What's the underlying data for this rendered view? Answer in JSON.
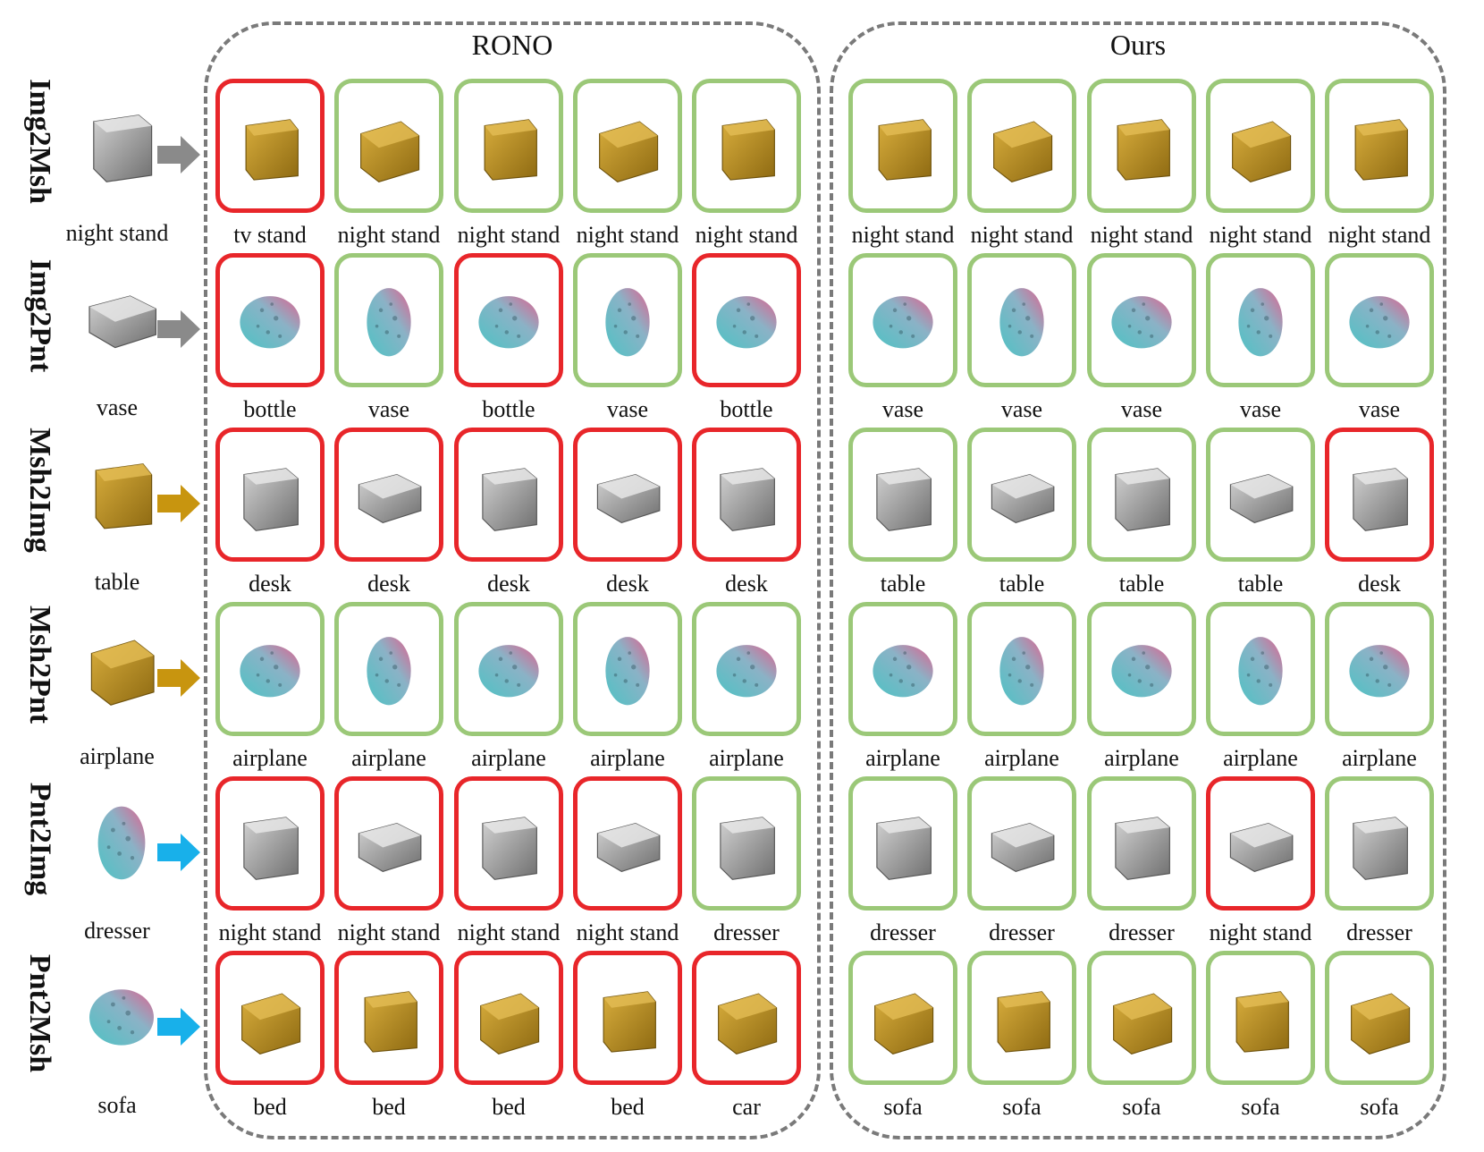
{
  "panels": {
    "left_title": "RONO",
    "right_title": "Ours"
  },
  "rows": [
    {
      "task": "Img2Msh",
      "query_label": "night stand",
      "query_style": "gray-mesh",
      "arrow_color": "#8a8a8a",
      "result_style": "gold-mesh",
      "left": [
        {
          "label": "tv stand",
          "correct": false
        },
        {
          "label": "night stand",
          "correct": true
        },
        {
          "label": "night stand",
          "correct": true
        },
        {
          "label": "night stand",
          "correct": true
        },
        {
          "label": "night stand",
          "correct": true
        }
      ],
      "right": [
        {
          "label": "night stand",
          "correct": true
        },
        {
          "label": "night stand",
          "correct": true
        },
        {
          "label": "night stand",
          "correct": true
        },
        {
          "label": "night stand",
          "correct": true
        },
        {
          "label": "night stand",
          "correct": true
        }
      ]
    },
    {
      "task": "Img2Pnt",
      "query_label": "vase",
      "query_style": "gray-mesh",
      "arrow_color": "#8a8a8a",
      "result_style": "point-cloud",
      "left": [
        {
          "label": "bottle",
          "correct": false
        },
        {
          "label": "vase",
          "correct": true
        },
        {
          "label": "bottle",
          "correct": false
        },
        {
          "label": "vase",
          "correct": true
        },
        {
          "label": "bottle",
          "correct": false
        }
      ],
      "right": [
        {
          "label": "vase",
          "correct": true
        },
        {
          "label": "vase",
          "correct": true
        },
        {
          "label": "vase",
          "correct": true
        },
        {
          "label": "vase",
          "correct": true
        },
        {
          "label": "vase",
          "correct": true
        }
      ]
    },
    {
      "task": "Msh2Img",
      "query_label": "table",
      "query_style": "gold-mesh",
      "arrow_color": "#c8950f",
      "result_style": "gray-mesh",
      "left": [
        {
          "label": "desk",
          "correct": false
        },
        {
          "label": "desk",
          "correct": false
        },
        {
          "label": "desk",
          "correct": false
        },
        {
          "label": "desk",
          "correct": false
        },
        {
          "label": "desk",
          "correct": false
        }
      ],
      "right": [
        {
          "label": "table",
          "correct": true
        },
        {
          "label": "table",
          "correct": true
        },
        {
          "label": "table",
          "correct": true
        },
        {
          "label": "table",
          "correct": true
        },
        {
          "label": "desk",
          "correct": false
        }
      ]
    },
    {
      "task": "Msh2Pnt",
      "query_label": "airplane",
      "query_style": "gold-mesh",
      "arrow_color": "#c8950f",
      "result_style": "point-cloud",
      "left": [
        {
          "label": "airplane",
          "correct": true
        },
        {
          "label": "airplane",
          "correct": true
        },
        {
          "label": "airplane",
          "correct": true
        },
        {
          "label": "airplane",
          "correct": true
        },
        {
          "label": "airplane",
          "correct": true
        }
      ],
      "right": [
        {
          "label": "airplane",
          "correct": true
        },
        {
          "label": "airplane",
          "correct": true
        },
        {
          "label": "airplane",
          "correct": true
        },
        {
          "label": "airplane",
          "correct": true
        },
        {
          "label": "airplane",
          "correct": true
        }
      ]
    },
    {
      "task": "Pnt2Img",
      "query_label": "dresser",
      "query_style": "point-cloud",
      "arrow_color": "#18b0ea",
      "result_style": "gray-mesh",
      "left": [
        {
          "label": "night stand",
          "correct": false
        },
        {
          "label": "night stand",
          "correct": false
        },
        {
          "label": "night stand",
          "correct": false
        },
        {
          "label": "night stand",
          "correct": false
        },
        {
          "label": "dresser",
          "correct": true
        }
      ],
      "right": [
        {
          "label": "dresser",
          "correct": true
        },
        {
          "label": "dresser",
          "correct": true
        },
        {
          "label": "dresser",
          "correct": true
        },
        {
          "label": "night stand",
          "correct": false
        },
        {
          "label": "dresser",
          "correct": true
        }
      ]
    },
    {
      "task": "Pnt2Msh",
      "query_label": "sofa",
      "query_style": "point-cloud",
      "arrow_color": "#18b0ea",
      "result_style": "gold-mesh",
      "left": [
        {
          "label": "bed",
          "correct": false
        },
        {
          "label": "bed",
          "correct": false
        },
        {
          "label": "bed",
          "correct": false
        },
        {
          "label": "bed",
          "correct": false
        },
        {
          "label": "car",
          "correct": false
        }
      ],
      "right": [
        {
          "label": "sofa",
          "correct": true
        },
        {
          "label": "sofa",
          "correct": true
        },
        {
          "label": "sofa",
          "correct": true
        },
        {
          "label": "sofa",
          "correct": true
        },
        {
          "label": "sofa",
          "correct": true
        }
      ]
    }
  ]
}
